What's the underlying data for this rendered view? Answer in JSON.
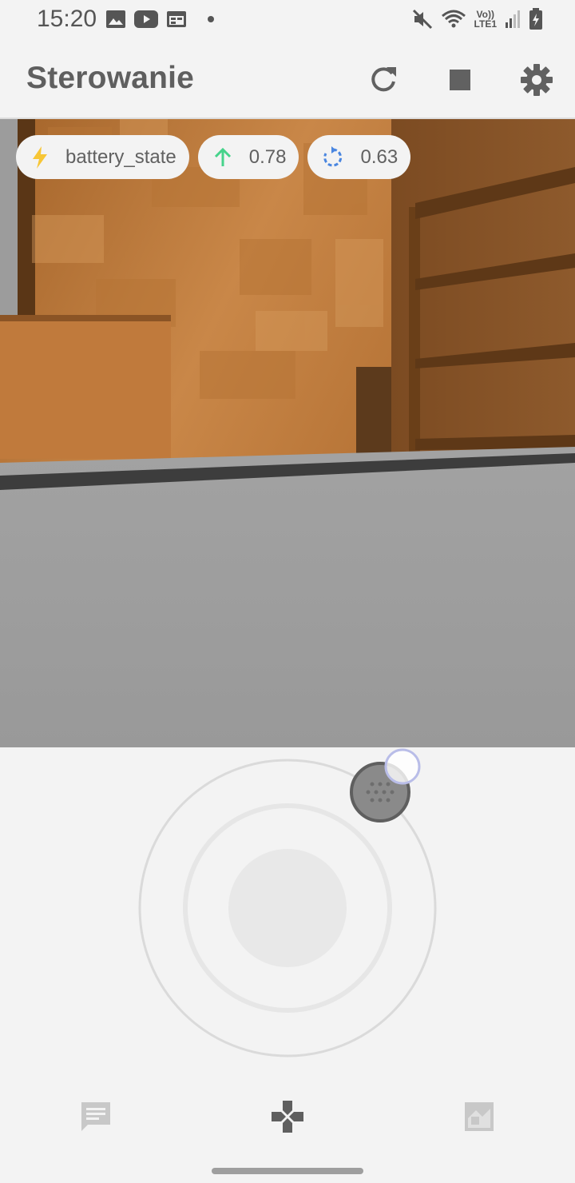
{
  "status_bar": {
    "time": "15:20",
    "left_icons": [
      "image-icon",
      "youtube-icon",
      "calendar-icon"
    ],
    "right_icons": [
      "mute-icon",
      "wifi-icon",
      "volte-lte-icon",
      "signal-icon",
      "battery-charging-icon"
    ],
    "volte_line1": "Vo))",
    "volte_line2": "LTE1"
  },
  "app_bar": {
    "title": "Sterowanie",
    "actions": [
      "refresh-icon",
      "stop-icon",
      "settings-icon"
    ]
  },
  "chips": [
    {
      "icon": "lightning-icon",
      "label": "battery_state",
      "icon_color": "#f7c636"
    },
    {
      "icon": "arrow-up-icon",
      "label": "0.78",
      "icon_color": "#46d38b"
    },
    {
      "icon": "rotate-icon",
      "label": "0.63",
      "icon_color": "#4a86e0"
    }
  ],
  "bottom_nav": {
    "items": [
      "chat-icon",
      "gamepad-icon",
      "map-icon"
    ],
    "active_index": 1
  }
}
